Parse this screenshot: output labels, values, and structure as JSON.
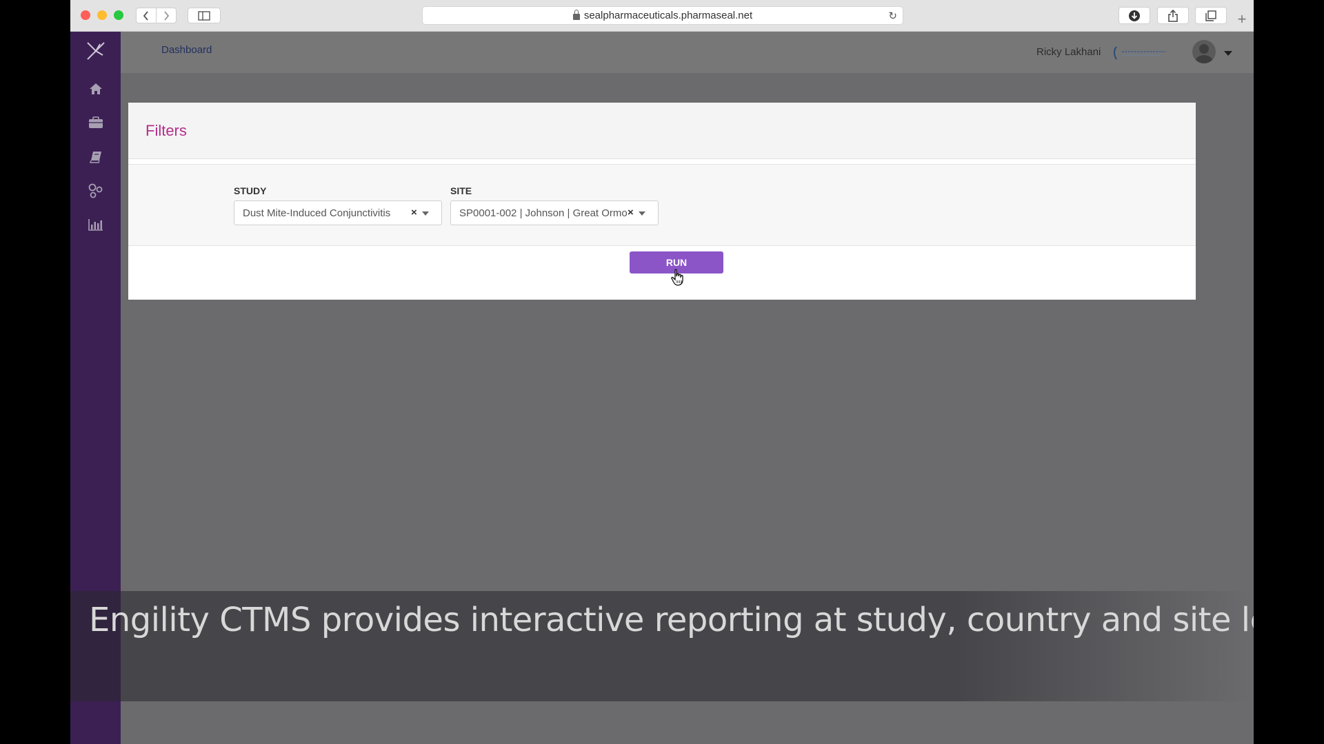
{
  "browser": {
    "url": "sealpharmaceuticals.pharmaseal.net"
  },
  "sidebar": {
    "logo": "engility-logo-icon",
    "items": [
      {
        "icon": "home-icon"
      },
      {
        "icon": "briefcase-icon"
      },
      {
        "icon": "book-icon"
      },
      {
        "icon": "network-icon"
      },
      {
        "icon": "bar-chart-icon"
      }
    ]
  },
  "topbar": {
    "breadcrumb": "Dashboard",
    "user_name": "Ricky Lakhani"
  },
  "filters": {
    "title": "Filters",
    "study": {
      "label": "STUDY",
      "value": "Dust Mite-Induced Conjunctivitis",
      "clear": "×"
    },
    "site": {
      "label": "SITE",
      "value": "SP0001-002 | Johnson | Great Ormo...",
      "clear": "×"
    },
    "run_label": "RUN"
  },
  "caption": "Engility CTMS provides interactive reporting at study, country and site level",
  "colors": {
    "sidebar": "#3c2054",
    "title": "#b22e8c",
    "run_button": "#8b55c8"
  }
}
